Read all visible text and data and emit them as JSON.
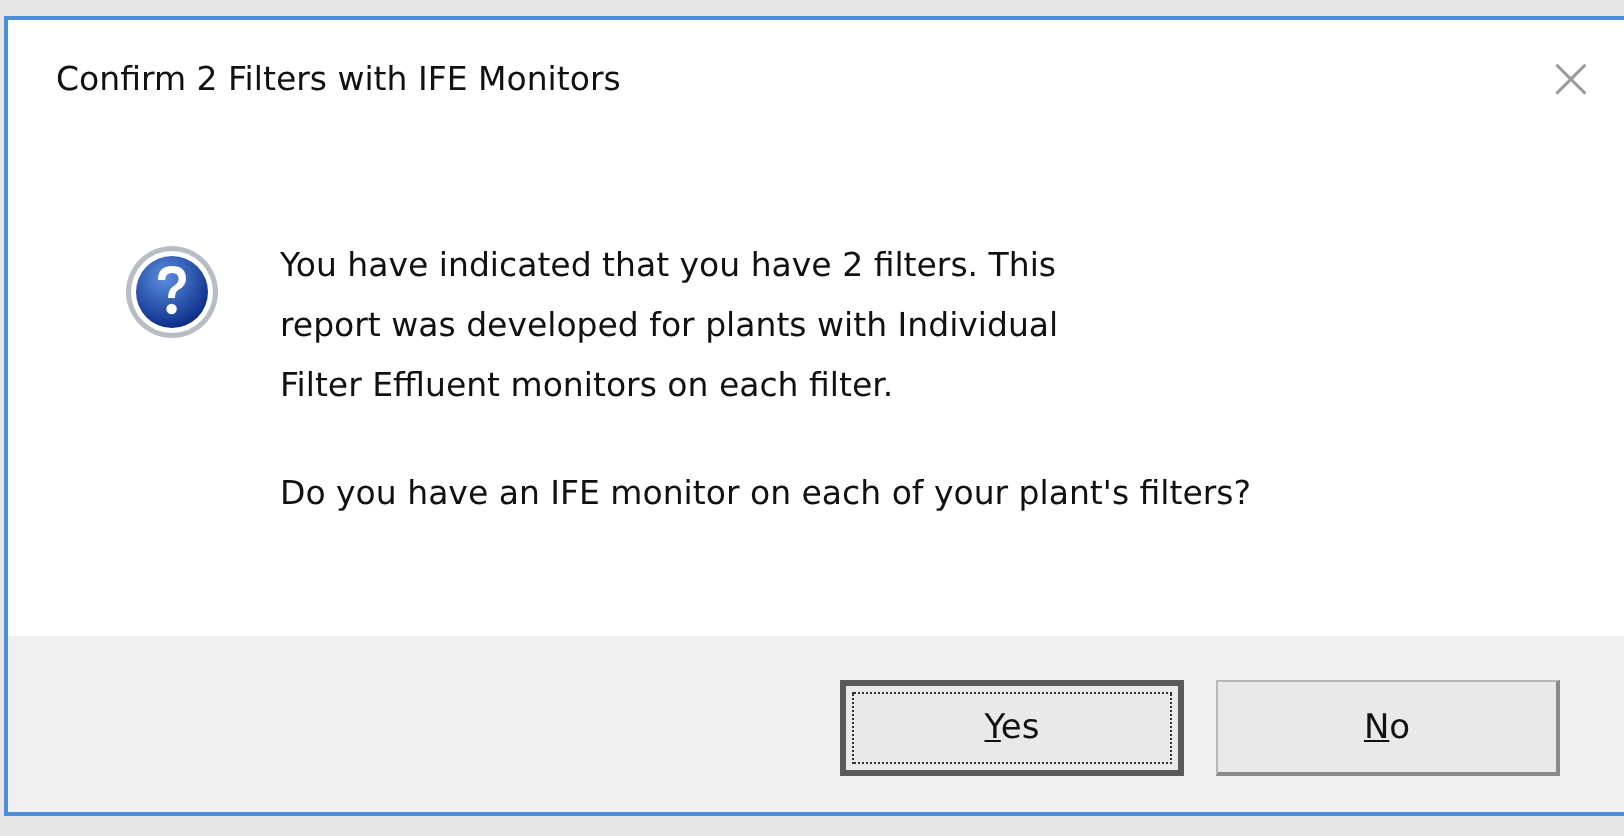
{
  "window": {
    "title": "Confirm 2 Filters with IFE Monitors",
    "close": "×"
  },
  "message": {
    "paragraphs": [
      "You have indicated that you have 2 filters. This\nreport was developed for plants with Individual\nFilter Effluent monitors on each filter.",
      "Do you have an IFE monitor on each of your plant's filters?"
    ]
  },
  "buttons": [
    {
      "accelerator": "Y",
      "rest": "es",
      "default": true
    },
    {
      "accelerator": "N",
      "rest": "o",
      "default": false
    }
  ]
}
